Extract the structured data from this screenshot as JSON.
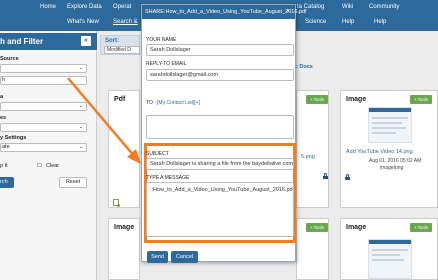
{
  "nav": {
    "row1": [
      "Home",
      "Explore Data",
      "Operat",
      "ta Catalog",
      "Wiki",
      "Community"
    ],
    "row2": [
      "What's New",
      "Search &",
      "Science",
      "Help",
      "Help"
    ]
  },
  "left_panel": {
    "title": "h and Filter",
    "collapse_label": "«",
    "labels": [
      "Source",
      "a",
      "es",
      "y Settings"
    ],
    "selects": [
      "",
      "h",
      "",
      "",
      "ate"
    ],
    "checkbox1": "p It",
    "checkbox2": "Clear",
    "search_label": "rch",
    "reset_label": "Reset"
  },
  "sort": {
    "label": "Sort:",
    "value": "Modified D"
  },
  "public_docs": "ublic Docs",
  "cards": {
    "pdf_type": "Pdf",
    "image1_type": "Image",
    "image2_type": "Image",
    "image3_type": "Image",
    "tools_label": "+ Tools",
    "png_partial": "5.png",
    "image_link": "Add YouTube Video 14.png",
    "image_date": "Aug 01, 2016 05:02 AM",
    "image_kind": "image/png",
    "image_partial_top": "Image"
  },
  "modal": {
    "title": "SHARE:How_to_Add_a_Video_Using_YouTube_August_2016.pdf",
    "close": "×",
    "your_name_label": "YOUR NAME",
    "your_name_value": "Sarah Dollslager",
    "reply_to_label": "REPLY-TO EMAIL",
    "reply_to_value": "sarahdollslager@gmail.com",
    "to_label": "TO :",
    "to_value": "[My Contact List][+]",
    "subject_label": "SUBJECT",
    "subject_value": "Sarah Dollslager is sharing a file from the baydeltalive.com",
    "message_label": "TYPE A MESSAGE",
    "message_value": "::How_to_Add_a_Video_Using_YouTube_August_2016.pdf",
    "send_label": "Send",
    "cancel_label": "Cancel"
  },
  "colors": {
    "header": "#2d6a9b",
    "highlight": "#f47b20",
    "tools": "#6aa84f"
  }
}
